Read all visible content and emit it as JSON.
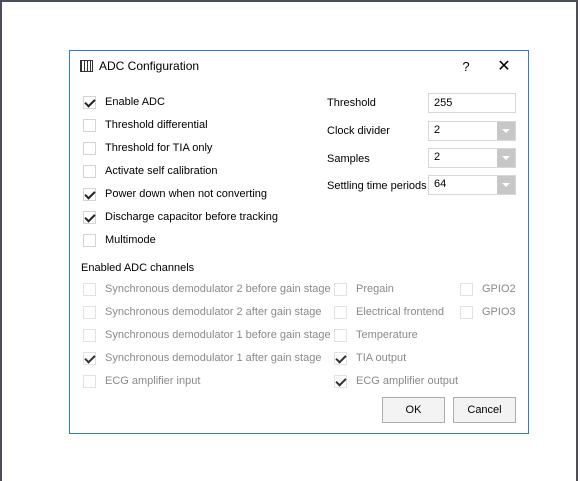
{
  "dialog": {
    "title": "ADC Configuration",
    "help_label": "?",
    "close_label": "✕",
    "icon": "app-chip-icon"
  },
  "options": [
    {
      "label": "Enable ADC",
      "checked": true
    },
    {
      "label": "Threshold differential",
      "checked": false
    },
    {
      "label": "Threshold for TIA only",
      "checked": false
    },
    {
      "label": "Activate self calibration",
      "checked": false
    },
    {
      "label": "Power down when not converting",
      "checked": true
    },
    {
      "label": "Discharge capacitor before tracking",
      "checked": true
    },
    {
      "label": "Multimode",
      "checked": false
    }
  ],
  "settings": {
    "threshold": {
      "label": "Threshold",
      "value": "255"
    },
    "clock_divider": {
      "label": "Clock divider",
      "value": "2"
    },
    "samples": {
      "label": "Samples",
      "value": "2"
    },
    "settling": {
      "label": "Settling time periods",
      "value": "64"
    }
  },
  "channels": {
    "heading": "Enabled ADC channels",
    "col1": [
      {
        "label": "Synchronous demodulator 2 before gain stage",
        "checked": false
      },
      {
        "label": "Synchronous demodulator 2 after gain stage",
        "checked": false
      },
      {
        "label": "Synchronous demodulator 1 before gain stage",
        "checked": false
      },
      {
        "label": "Synchronous demodulator 1 after gain stage",
        "checked": true
      },
      {
        "label": "ECG amplifier input",
        "checked": false
      }
    ],
    "col2": [
      {
        "label": "Pregain",
        "checked": false
      },
      {
        "label": "Electrical frontend",
        "checked": false
      },
      {
        "label": "Temperature",
        "checked": false
      },
      {
        "label": "TIA output",
        "checked": true
      },
      {
        "label": "ECG amplifier output",
        "checked": true
      }
    ],
    "col3": [
      {
        "label": "GPIO2",
        "checked": false
      },
      {
        "label": "GPIO3",
        "checked": false
      }
    ]
  },
  "buttons": {
    "ok": "OK",
    "cancel": "Cancel"
  },
  "colors": {
    "dialog_border": "#2b7bd1",
    "disabled_text": "#8a8a8a",
    "combo_arrow": "#c7c7c7"
  }
}
